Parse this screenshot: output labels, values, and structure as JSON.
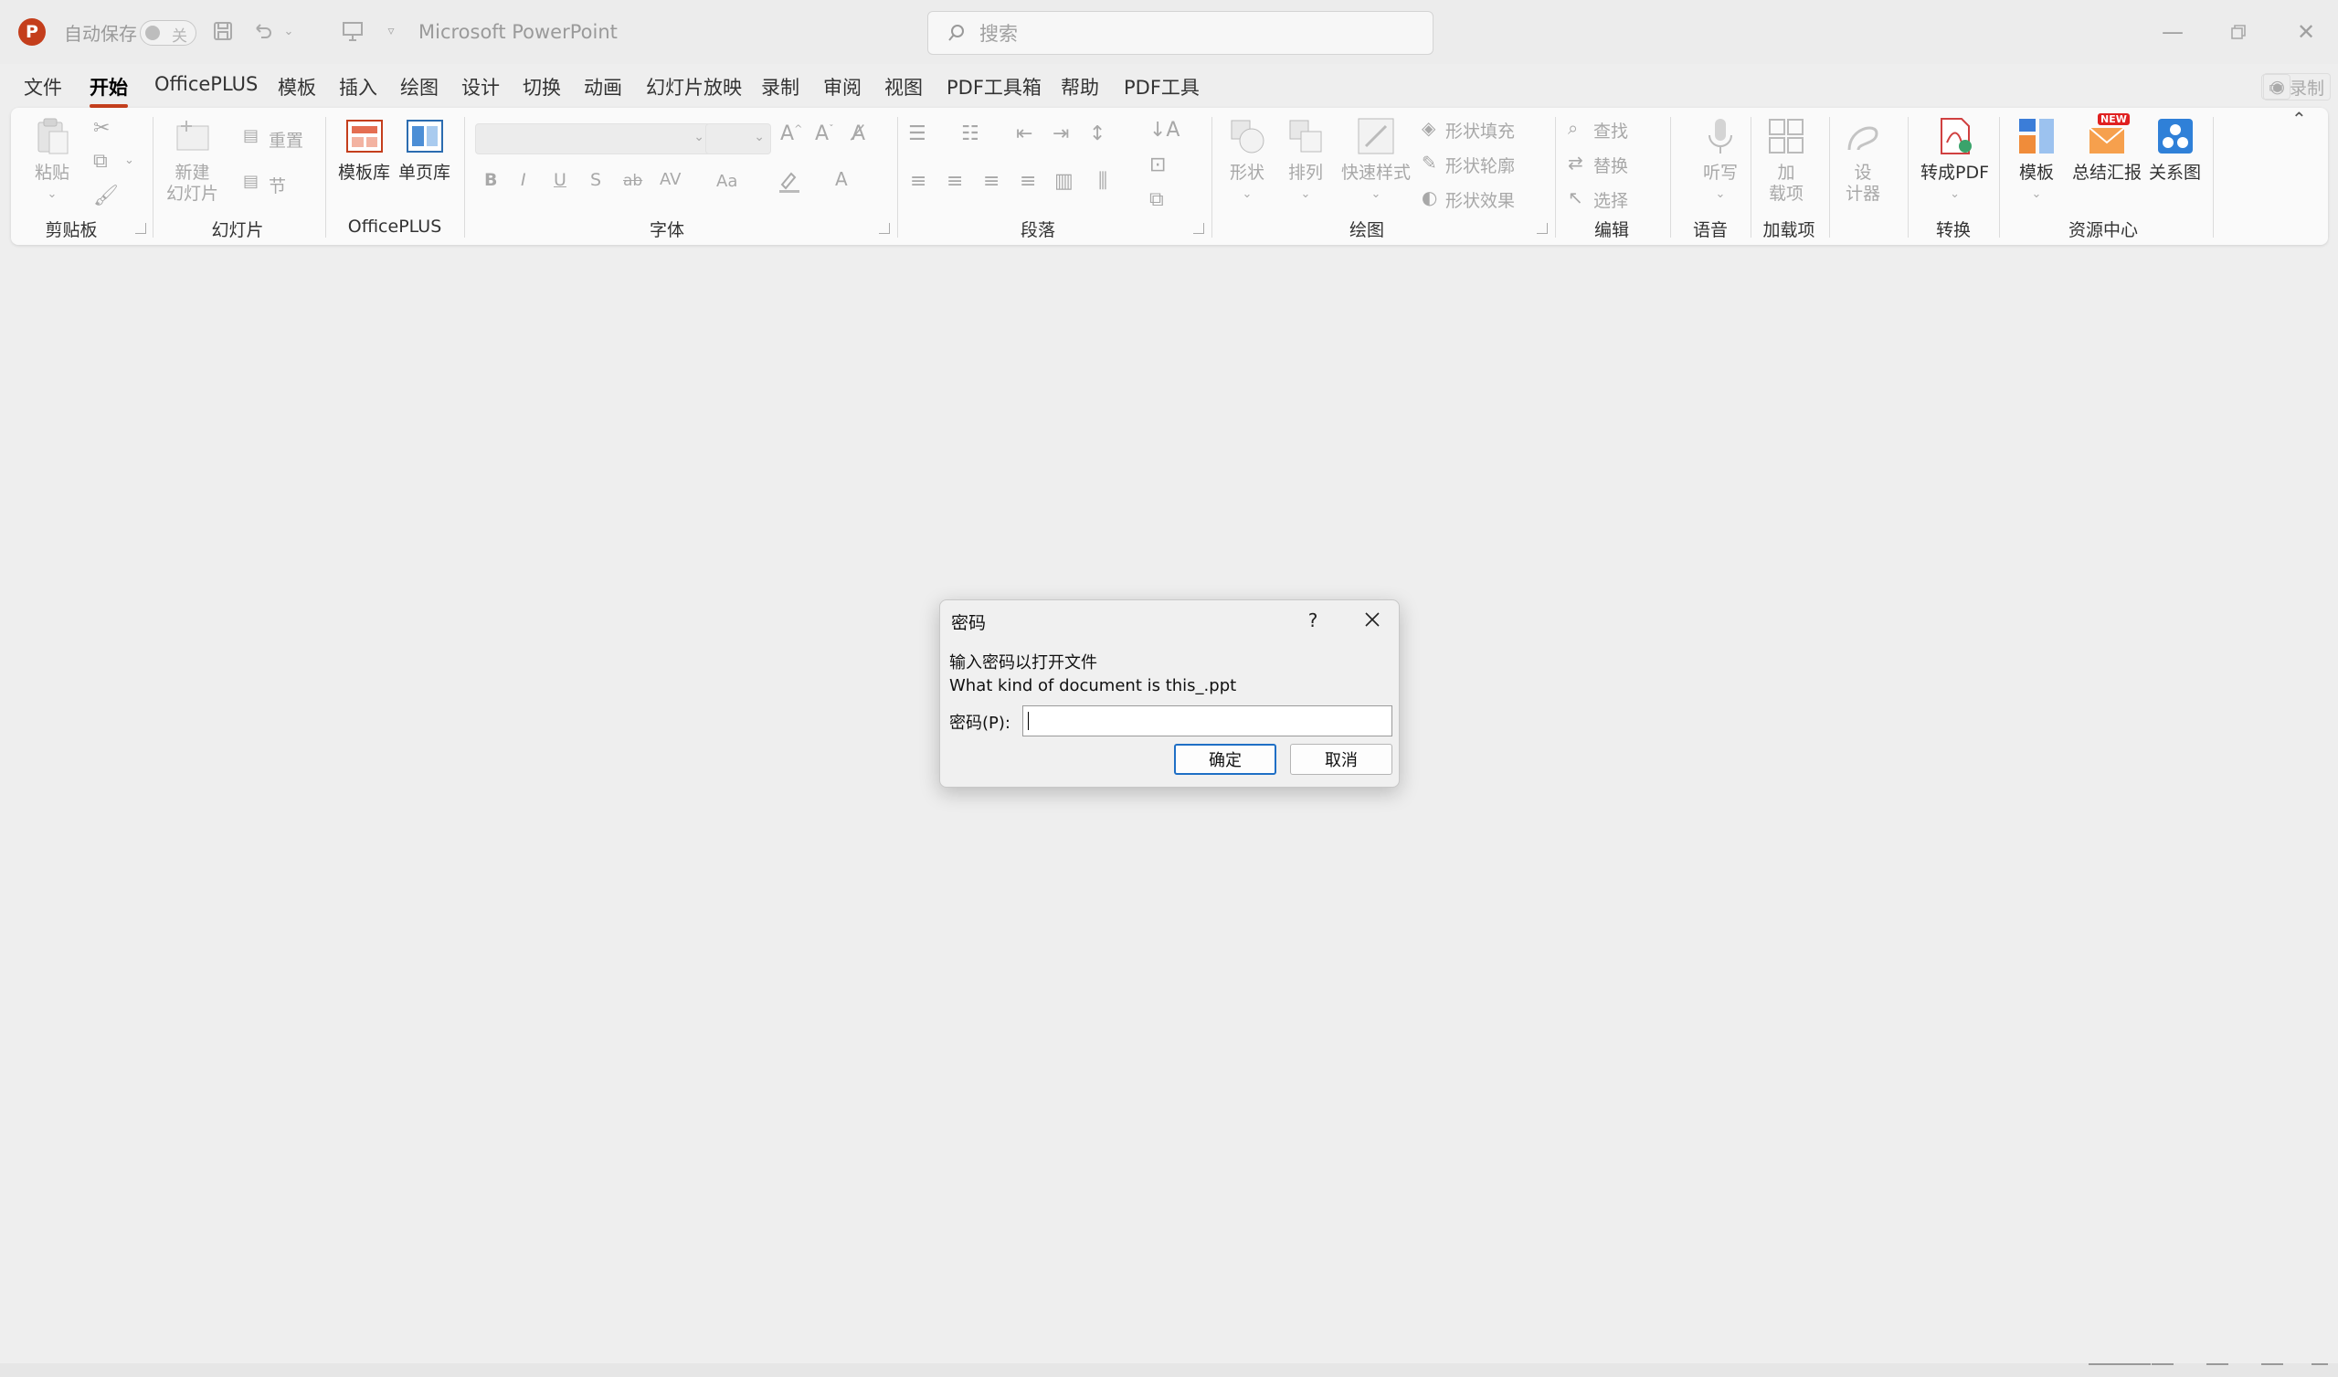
{
  "titlebar": {
    "autosave_label": "自动保存",
    "autosave_state": "关",
    "app_title": "Microsoft PowerPoint",
    "search_placeholder": "搜索"
  },
  "menu": {
    "tabs": [
      "文件",
      "开始",
      "OfficePLUS",
      "模板",
      "插入",
      "绘图",
      "设计",
      "切换",
      "动画",
      "幻灯片放映",
      "录制",
      "审阅",
      "视图",
      "PDF工具箱",
      "帮助",
      "PDF工具"
    ],
    "active_tab": "开始",
    "record_label": "录制"
  },
  "ribbon": {
    "groups": {
      "clipboard": "剪贴板",
      "slides": "幻灯片",
      "officeplus": "OfficePLUS",
      "font": "字体",
      "paragraph": "段落",
      "drawing": "绘图",
      "editing": "编辑",
      "voice": "语音",
      "addins": "加载项",
      "convert": "转换",
      "resource": "资源中心"
    },
    "paste": "粘贴",
    "new_slide_line1": "新建",
    "new_slide_line2": "幻灯片",
    "reset": "重置",
    "section": "节",
    "template_lib": "模板库",
    "single_page_lib": "单页库",
    "shapes": "形状",
    "arrange": "排列",
    "quick_styles": "快速样式",
    "shape_fill": "形状填充",
    "shape_outline": "形状轮廓",
    "shape_effects": "形状效果",
    "find": "查找",
    "replace": "替换",
    "select": "选择",
    "dictate": "听写",
    "addins_line1": "加",
    "addins_line2": "载项",
    "designer_line1": "设",
    "designer_line2": "计器",
    "to_pdf": "转成PDF",
    "template": "模板",
    "summary": "总结汇报",
    "relation": "关系图",
    "new_badge": "NEW",
    "font_buttons": [
      "B",
      "I",
      "U",
      "S",
      "ab",
      "AV",
      "Aa",
      "A"
    ]
  },
  "dialog": {
    "title": "密码",
    "help": "?",
    "message": "输入密码以打开文件",
    "filename": "What kind of document is this_.ppt",
    "field_label": "密码(P):",
    "password_value": "",
    "ok": "确定",
    "cancel": "取消"
  },
  "colors": {
    "accent": "#c43e1c",
    "dialog_default_border": "#1f6fc5"
  }
}
